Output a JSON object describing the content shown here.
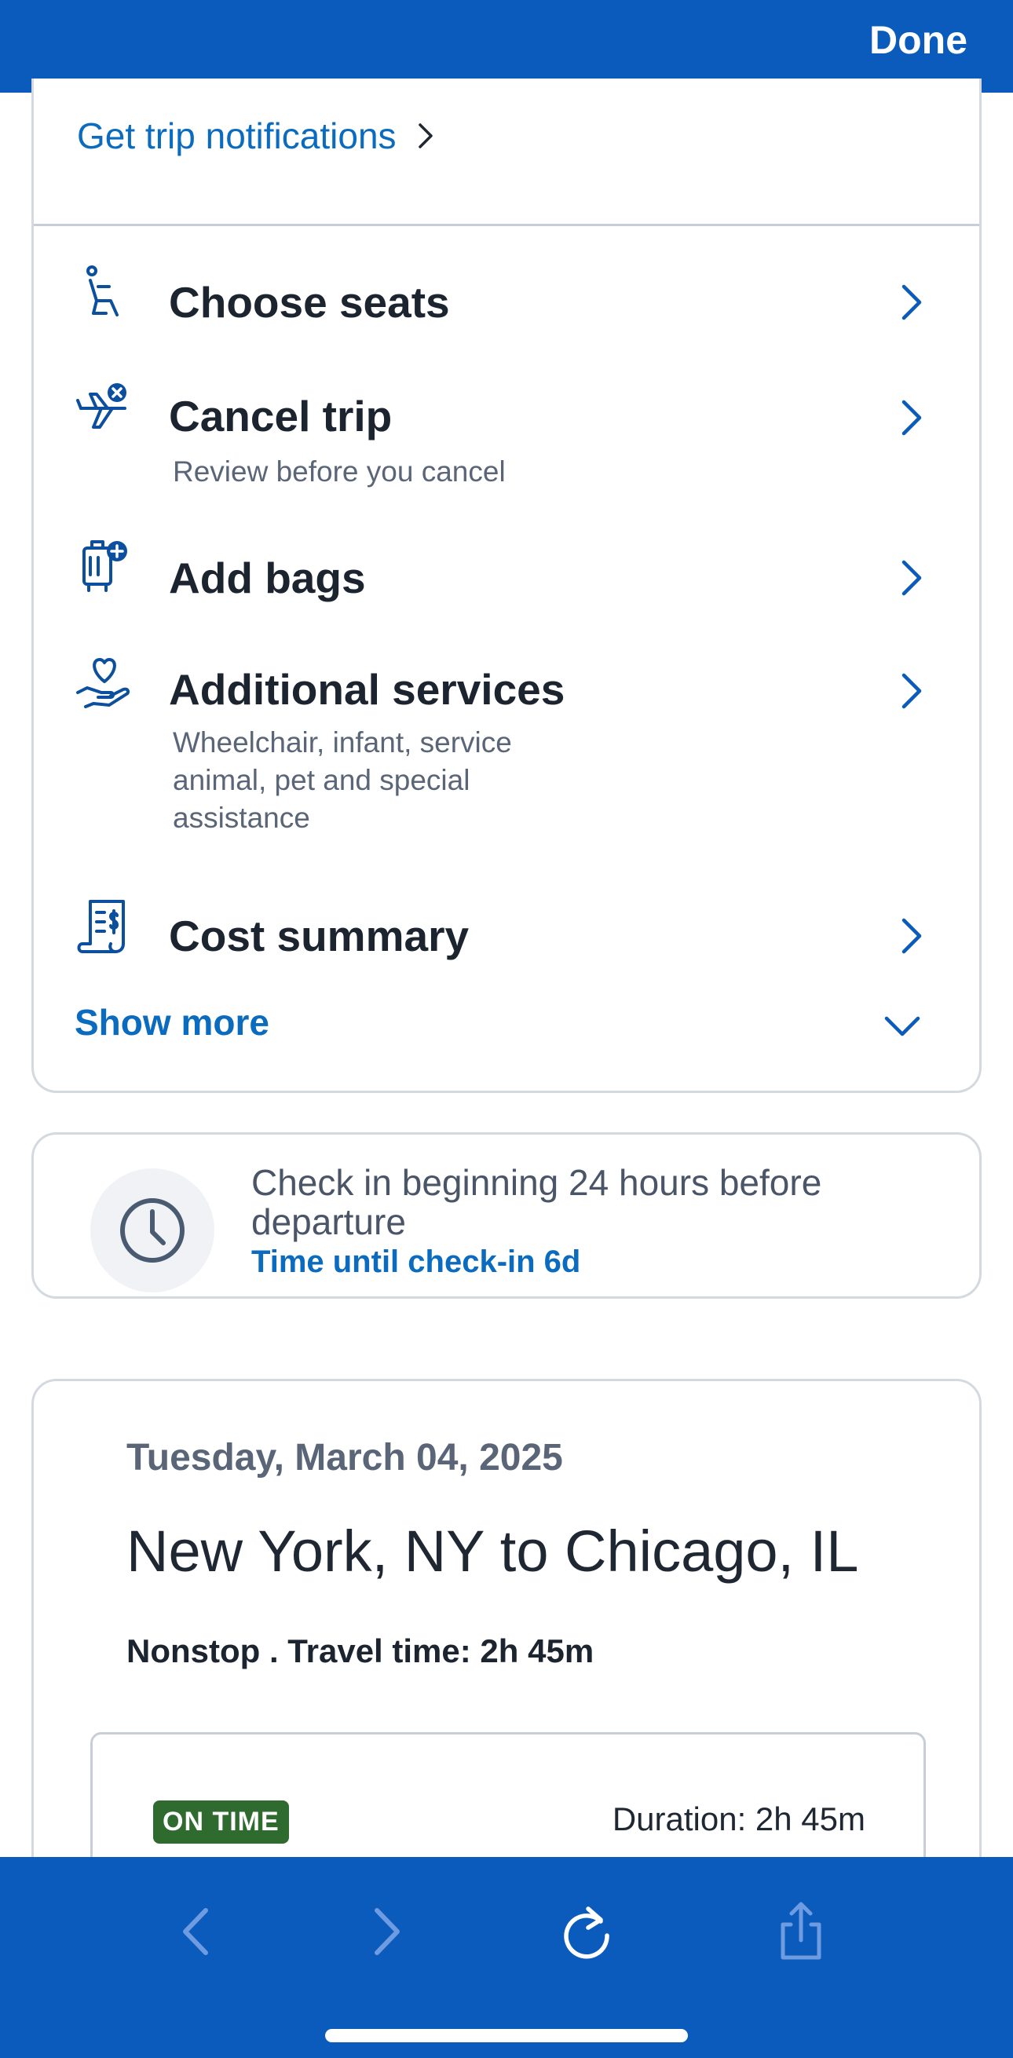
{
  "topbar": {
    "done_label": "Done"
  },
  "actions": {
    "notifications_link": "Get trip notifications",
    "items": [
      {
        "title": "Choose seats",
        "subtitle": "",
        "icon": "seat-icon"
      },
      {
        "title": "Cancel trip",
        "subtitle": "Review before you cancel",
        "icon": "plane-cancel-icon"
      },
      {
        "title": "Add bags",
        "subtitle": "",
        "icon": "bag-add-icon"
      },
      {
        "title": "Additional services",
        "subtitle": "Wheelchair, infant, service animal, pet and special assistance",
        "icon": "heart-hand-icon"
      },
      {
        "title": "Cost summary",
        "subtitle": "",
        "icon": "receipt-icon"
      }
    ],
    "show_more": "Show more"
  },
  "checkin": {
    "text": "Check in beginning 24 hours before departure",
    "time_until": "Time until check-in 6d",
    "icon": "clock-icon"
  },
  "flight": {
    "date": "Tuesday, March 04, 2025",
    "route": "New York, NY to Chicago, IL",
    "meta": "Nonstop . Travel time: 2h 45m",
    "status_badge": "ON TIME",
    "duration": "Duration: 2h 45m"
  },
  "browser_bar": {
    "icons": [
      "back-icon",
      "forward-icon",
      "reload-icon",
      "share-icon"
    ]
  },
  "colors": {
    "brand_blue": "#0b5bbd",
    "link_blue": "#0b6bbf",
    "on_time_green": "#2f6b2e"
  }
}
